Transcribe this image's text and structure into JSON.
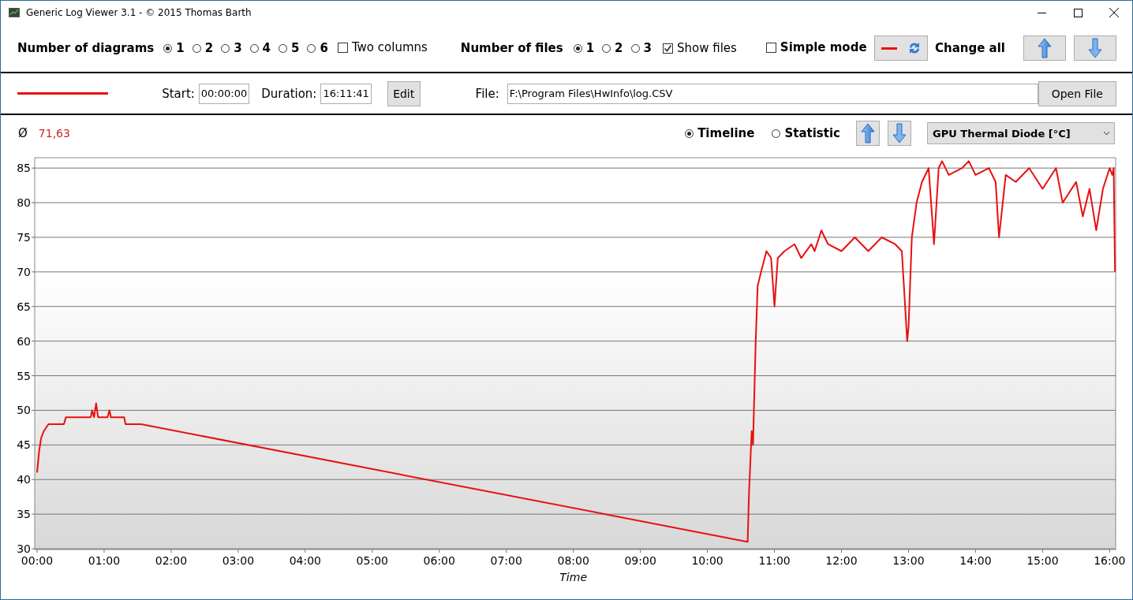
{
  "window": {
    "title": "Generic Log Viewer 3.1 - © 2015 Thomas Barth"
  },
  "options": {
    "diagrams_label": "Number of diagrams",
    "diagrams": [
      {
        "label": "1",
        "selected": true
      },
      {
        "label": "2",
        "selected": false
      },
      {
        "label": "3",
        "selected": false
      },
      {
        "label": "4",
        "selected": false
      },
      {
        "label": "5",
        "selected": false
      },
      {
        "label": "6",
        "selected": false
      }
    ],
    "two_columns": {
      "label": "Two columns",
      "checked": false
    },
    "files_label": "Number of files",
    "files": [
      {
        "label": "1",
        "selected": true
      },
      {
        "label": "2",
        "selected": false
      },
      {
        "label": "3",
        "selected": false
      }
    ],
    "show_files": {
      "label": "Show files",
      "checked": true
    },
    "simple_mode": {
      "label": "Simple mode",
      "checked": false
    },
    "change_all_label": "Change all"
  },
  "file_row": {
    "start_label": "Start:",
    "start": "00:00:00",
    "duration_label": "Duration:",
    "duration": "16:11:41",
    "edit_button": "Edit",
    "file_label": "File:",
    "file": "F:\\Program Files\\HwInfo\\log.CSV",
    "open_button": "Open File"
  },
  "diagram": {
    "avg_symbol": "Ø",
    "avg_value": "71,63",
    "modes": [
      {
        "label": "Timeline",
        "selected": true
      },
      {
        "label": "Statistic",
        "selected": false
      }
    ],
    "sensor": "GPU Thermal Diode [°C]",
    "chart_data": {
      "type": "line",
      "xlabel": "Time",
      "xticks": [
        {
          "value": 0,
          "label": "00:00"
        },
        {
          "value": 1,
          "label": "01:00"
        },
        {
          "value": 2,
          "label": "02:00"
        },
        {
          "value": 3,
          "label": "03:00"
        },
        {
          "value": 4,
          "label": "04:00"
        },
        {
          "value": 5,
          "label": "05:00"
        },
        {
          "value": 6,
          "label": "06:00"
        },
        {
          "value": 7,
          "label": "07:00"
        },
        {
          "value": 8,
          "label": "08:00"
        },
        {
          "value": 9,
          "label": "09:00"
        },
        {
          "value": 10,
          "label": "10:00"
        },
        {
          "value": 11,
          "label": "11:00"
        },
        {
          "value": 12,
          "label": "12:00"
        },
        {
          "value": 13,
          "label": "13:00"
        },
        {
          "value": 14,
          "label": "14:00"
        },
        {
          "value": 15,
          "label": "15:00"
        },
        {
          "value": 16,
          "label": "16:00"
        }
      ],
      "yticks": [
        30,
        35,
        40,
        45,
        50,
        55,
        60,
        65,
        70,
        75,
        80,
        85
      ],
      "grid": true,
      "xlim": [
        0,
        16.09
      ],
      "ylim": [
        30,
        86.5
      ],
      "x": [
        0,
        0.03,
        0.06,
        0.1,
        0.17,
        0.4,
        0.43,
        0.8,
        0.82,
        0.85,
        0.88,
        0.91,
        1.05,
        1.08,
        1.1,
        1.3,
        1.32,
        1.55,
        10.6,
        10.62,
        10.66,
        10.68,
        10.72,
        10.75,
        10.8,
        10.88,
        10.95,
        11.0,
        11.05,
        11.15,
        11.3,
        11.4,
        11.55,
        11.6,
        11.7,
        11.8,
        12.0,
        12.2,
        12.4,
        12.6,
        12.8,
        12.9,
        12.95,
        12.98,
        13.0,
        13.05,
        13.12,
        13.2,
        13.3,
        13.38,
        13.45,
        13.5,
        13.6,
        13.8,
        13.9,
        14.0,
        14.2,
        14.3,
        14.35,
        14.45,
        14.6,
        14.8,
        15.0,
        15.2,
        15.3,
        15.5,
        15.6,
        15.7,
        15.8,
        15.9,
        16.0,
        16.04,
        16.06,
        16.08
      ],
      "series": [
        {
          "color": "#e81010",
          "values": [
            41,
            44,
            46,
            47,
            48,
            48,
            49,
            49,
            50,
            49,
            51,
            49,
            49,
            50,
            49,
            49,
            48,
            48,
            31,
            38,
            47,
            45,
            60,
            68,
            70,
            73,
            72,
            65,
            72,
            73,
            74,
            72,
            74,
            73,
            76,
            74,
            73,
            75,
            73,
            75,
            74,
            73,
            65,
            60,
            62,
            75,
            80,
            83,
            85,
            74,
            85,
            86,
            84,
            85,
            86,
            84,
            85,
            83,
            75,
            84,
            83,
            85,
            82,
            85,
            80,
            83,
            78,
            82,
            76,
            82,
            85,
            84,
            85,
            70
          ]
        }
      ]
    }
  }
}
